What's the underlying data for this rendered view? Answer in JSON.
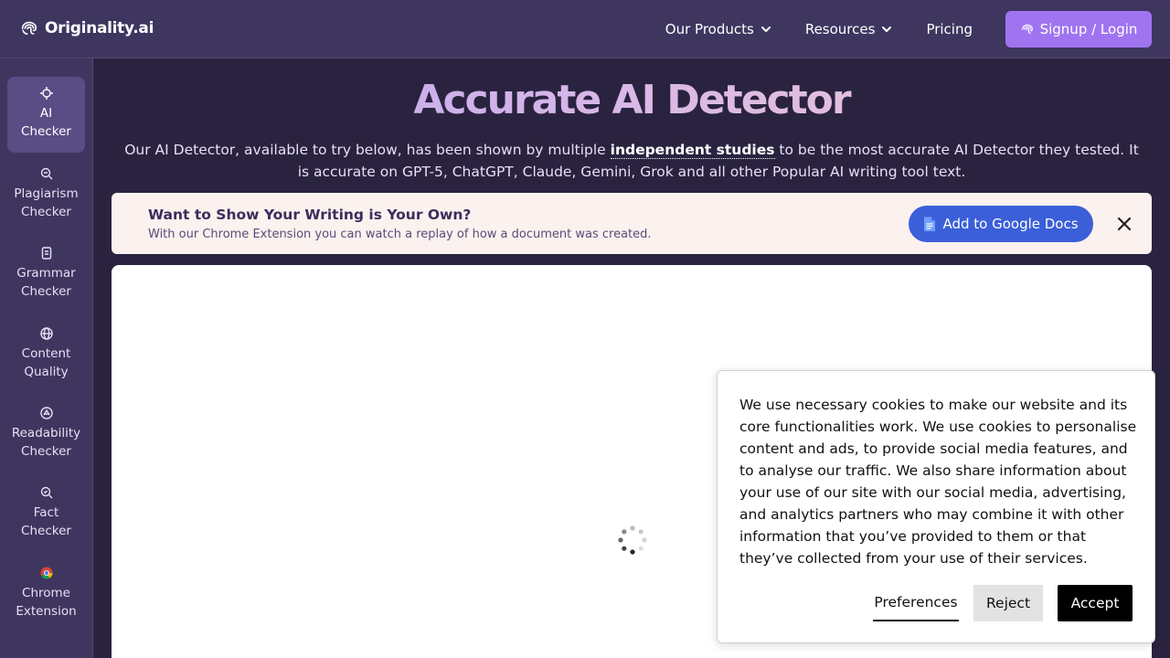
{
  "header": {
    "logo_text": "Originality.ai",
    "logo_icon": "brain-icon",
    "nav": [
      {
        "label": "Our Products",
        "has_dropdown": true
      },
      {
        "label": "Resources",
        "has_dropdown": true
      },
      {
        "label": "Pricing",
        "has_dropdown": false
      }
    ],
    "signup_label": "Signup / Login"
  },
  "sidebar": {
    "items": [
      {
        "line1": "AI",
        "line2": "Checker",
        "icon": "ai-checker-icon",
        "active": true
      },
      {
        "line1": "Plagiarism",
        "line2": "Checker",
        "icon": "magnifier-icon",
        "active": false
      },
      {
        "line1": "Grammar",
        "line2": "Checker",
        "icon": "clipboard-icon",
        "active": false
      },
      {
        "line1": "Content",
        "line2": "Quality",
        "icon": "globe-icon",
        "active": false
      },
      {
        "line1": "Readability",
        "line2": "Checker",
        "icon": "readability-icon",
        "active": false
      },
      {
        "line1": "Fact",
        "line2": "Checker",
        "icon": "magnifier-icon",
        "active": false
      },
      {
        "line1": "Chrome",
        "line2": "Extension",
        "icon": "chrome-icon",
        "active": false
      }
    ]
  },
  "hero": {
    "title": "Accurate AI Detector",
    "desc_before": "Our AI Detector, available to try below, has been shown by multiple ",
    "desc_link": "independent studies",
    "desc_after": " to be the most accurate AI Detector they tested. It is accurate on GPT-5, ChatGPT, Claude, Gemini, Grok and all other Popular AI writing tool text."
  },
  "banner": {
    "title": "Want to Show Your Writing is Your Own?",
    "subtitle": "With our Chrome Extension you can watch a replay of how a document was created.",
    "button_label": "Add to Google Docs"
  },
  "cookie": {
    "text": "We use necessary cookies to make our website and its core functionalities work. We use cookies to personalise content and ads, to provide social media features, and to analyse our traffic. We also share information about your use of our site with our social media, advertising, and analytics partners who may combine it with other information that you’ve provided to them or that they’ve collected from your use of their services.",
    "preferences_label": "Preferences",
    "reject_label": "Reject",
    "accept_label": "Accept"
  },
  "colors": {
    "nav_bg": "#3f3660",
    "page_bg": "#2a2340",
    "signup_bg": "#a074f0",
    "gdocs_btn": "#3b5fd9",
    "banner_bg": "#fbf1ee"
  }
}
